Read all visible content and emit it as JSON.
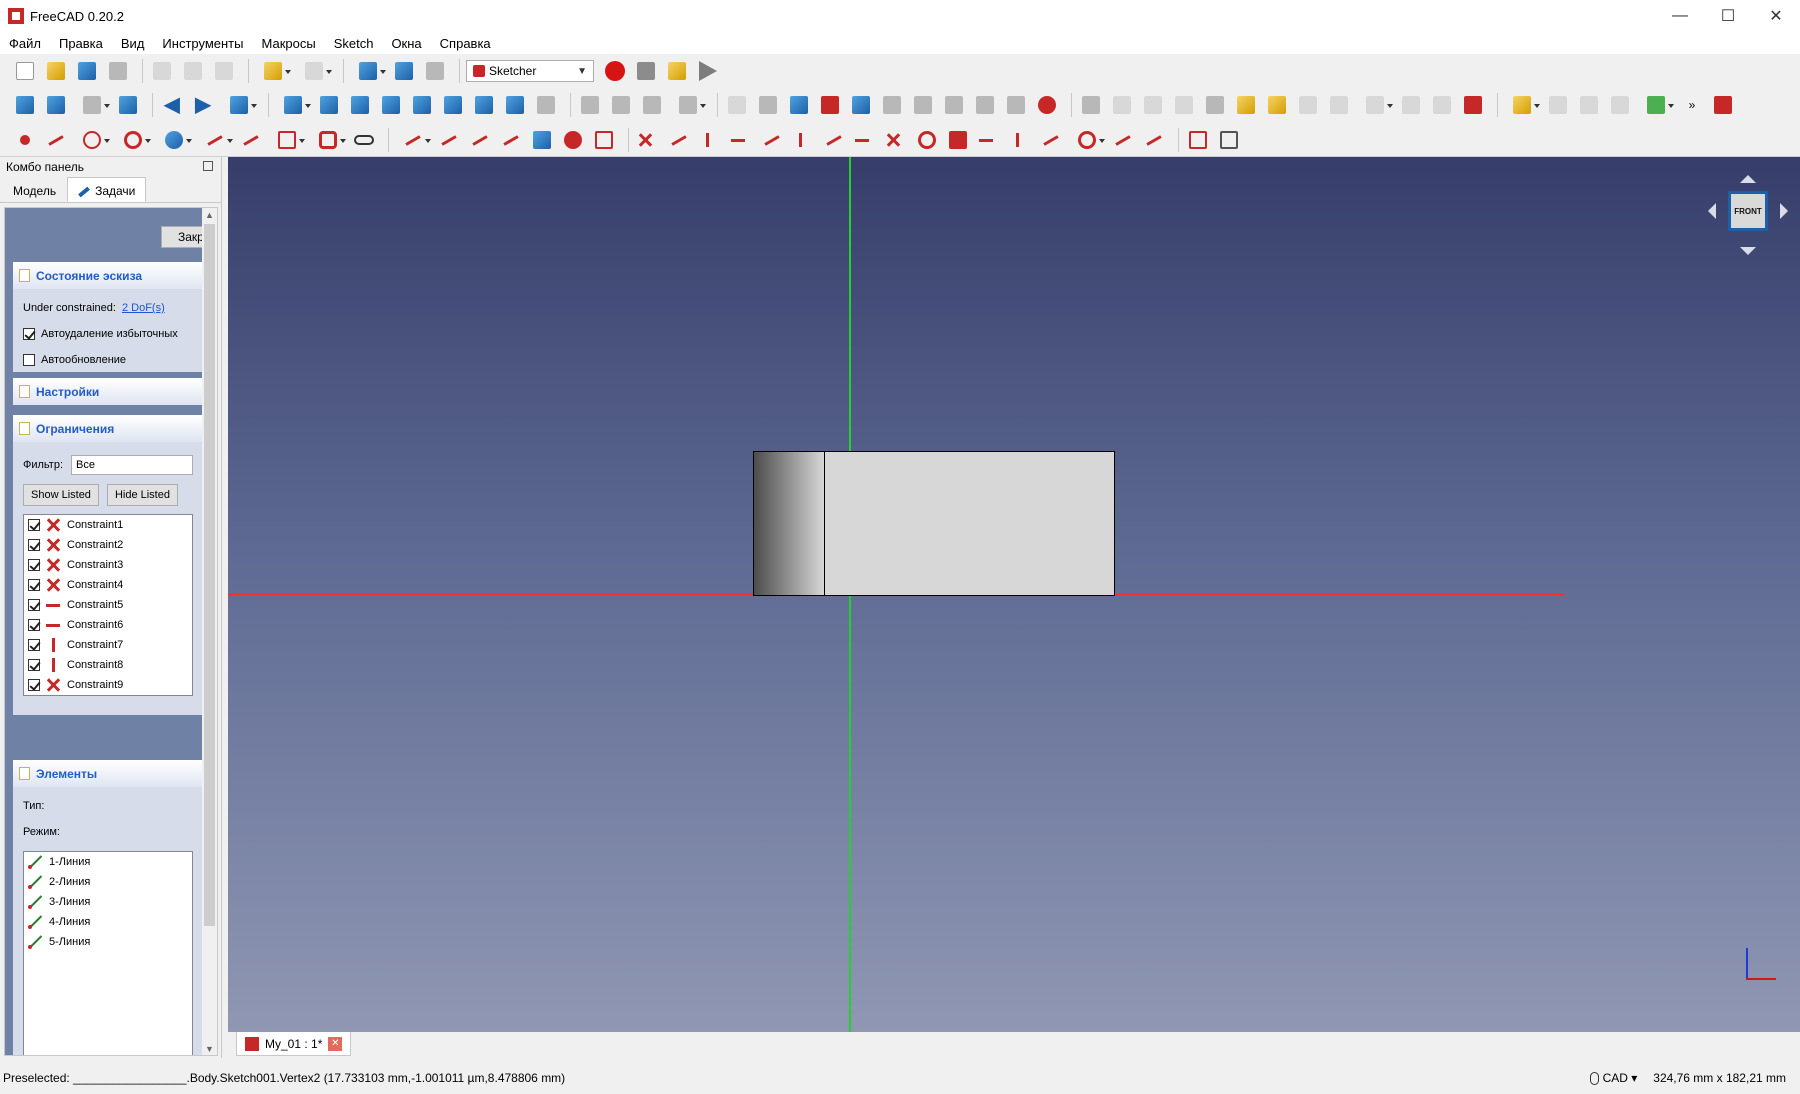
{
  "window": {
    "title": "FreeCAD 0.20.2",
    "controls": [
      "—",
      "☐",
      "✕"
    ]
  },
  "menu": [
    "Файл",
    "Правка",
    "Вид",
    "Инструменты",
    "Макросы",
    "Sketch",
    "Окна",
    "Справка"
  ],
  "toolbar": {
    "workbench": "Sketcher"
  },
  "combo": {
    "title": "Комбо панель",
    "tabs": [
      "Модель",
      "Задачи"
    ],
    "close_label": "Закрыть",
    "solver": {
      "title": "Состояние эскиза",
      "under_label": "Under constrained:",
      "dof_link": "2 DoF(s)",
      "auto_remove": "Автоудаление избыточных",
      "auto_update": "Автообновление"
    },
    "settings": {
      "title": "Настройки"
    },
    "constraints": {
      "title": "Ограничения",
      "filter_label": "Фильтр:",
      "filter_value": "Все",
      "show_listed": "Show Listed",
      "hide_listed": "Hide Listed",
      "items": [
        {
          "name": "Constraint1",
          "type": "coincident"
        },
        {
          "name": "Constraint2",
          "type": "coincident"
        },
        {
          "name": "Constraint3",
          "type": "coincident"
        },
        {
          "name": "Constraint4",
          "type": "coincident"
        },
        {
          "name": "Constraint5",
          "type": "horizontal"
        },
        {
          "name": "Constraint6",
          "type": "horizontal"
        },
        {
          "name": "Constraint7",
          "type": "vertical"
        },
        {
          "name": "Constraint8",
          "type": "vertical"
        },
        {
          "name": "Constraint9",
          "type": "coincident"
        }
      ]
    },
    "elements": {
      "title": "Элементы",
      "type_label": "Тип:",
      "mode_label": "Режим:",
      "items": [
        "1-Линия",
        "2-Линия",
        "3-Линия",
        "4-Линия",
        "5-Линия"
      ]
    }
  },
  "view": {
    "navcube_face": "FRONT"
  },
  "doc_tab": {
    "label": "My_01 : 1*"
  },
  "status": {
    "preselected": "Preselected: _________________.Body.Sketch001.Vertex2 (17.733103 mm,-1.001011 µm,8.478806 mm)",
    "nav_style": "CAD",
    "dimensions": "324,76 mm x 182,21 mm"
  }
}
